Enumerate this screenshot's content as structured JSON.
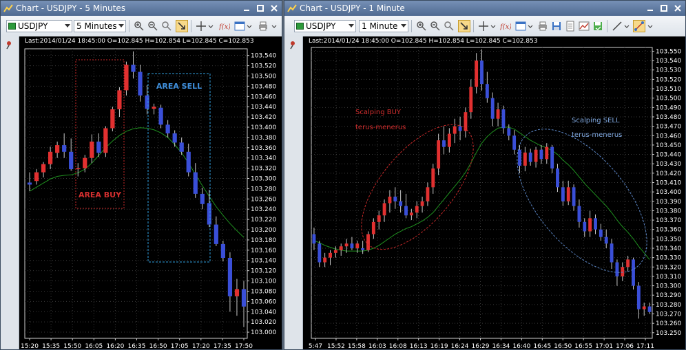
{
  "left": {
    "title": "Chart - USDJPY - 5 Minutes",
    "symbol": "USDJPY",
    "timeframe": "5 Minutes",
    "last_info": "Last:2014/01/24 18:45:00 O=102.845 H=102.854 L=102.845 C=102.853",
    "annotations": {
      "buy": "AREA BUY",
      "sell": "AREA SELL"
    },
    "colors": {
      "bull": "#e23030",
      "bear": "#3a4fd8",
      "ma": "#1f8f1f",
      "buy_box": "#c62828",
      "sell_box": "#2f9fe0"
    },
    "chart_data": {
      "type": "candlestick",
      "x_labels": [
        "15:20",
        "15:35",
        "15:50",
        "16:05",
        "16:20",
        "16:35",
        "16:50",
        "17:05",
        "17:20",
        "17:35",
        "17:50"
      ],
      "y_ticks": [
        "103.540",
        "103.520",
        "103.500",
        "103.480",
        "103.460",
        "103.440",
        "103.420",
        "103.400",
        "103.380",
        "103.360",
        "103.340",
        "103.320",
        "103.300",
        "103.280",
        "103.260",
        "103.240",
        "103.220",
        "103.200",
        "103.180",
        "103.160",
        "103.140",
        "103.120",
        "103.100",
        "103.080",
        "103.060",
        "103.040",
        "103.020",
        "103.000"
      ],
      "ylim": [
        102.988,
        103.553
      ],
      "candles": [
        [
          103.292,
          103.312,
          103.275,
          103.288
        ],
        [
          103.295,
          103.318,
          103.288,
          103.312
        ],
        [
          103.312,
          103.332,
          103.302,
          103.328
        ],
        [
          103.328,
          103.362,
          103.318,
          103.352
        ],
        [
          103.35,
          103.372,
          103.34,
          103.365
        ],
        [
          103.365,
          103.388,
          103.34,
          103.352
        ],
        [
          103.352,
          103.378,
          103.315,
          103.318
        ],
        [
          103.318,
          103.33,
          103.304,
          103.32
        ],
        [
          103.32,
          103.346,
          103.312,
          103.34
        ],
        [
          103.34,
          103.386,
          103.33,
          103.372
        ],
        [
          103.372,
          103.388,
          103.342,
          103.35
        ],
        [
          103.35,
          103.402,
          103.342,
          103.398
        ],
        [
          103.398,
          103.44,
          103.392,
          103.435
        ],
        [
          103.435,
          103.478,
          103.42,
          103.472
        ],
        [
          103.472,
          103.528,
          103.462,
          103.522
        ],
        [
          103.522,
          103.548,
          103.495,
          103.508
        ],
        [
          103.508,
          103.522,
          103.45,
          103.462
        ],
        [
          103.462,
          103.482,
          103.425,
          103.436
        ],
        [
          103.436,
          103.446,
          103.425,
          103.44
        ],
        [
          103.438,
          103.444,
          103.398,
          103.405
        ],
        [
          103.405,
          103.414,
          103.38,
          103.388
        ],
        [
          103.388,
          103.394,
          103.362,
          103.37
        ],
        [
          103.37,
          103.38,
          103.346,
          103.352
        ],
        [
          103.352,
          103.368,
          103.304,
          103.312
        ],
        [
          103.312,
          103.33,
          103.262,
          103.27
        ],
        [
          103.27,
          103.282,
          103.24,
          103.25
        ],
        [
          103.252,
          103.278,
          103.205,
          103.21
        ],
        [
          103.21,
          103.226,
          103.168,
          103.172
        ],
        [
          103.172,
          103.178,
          103.138,
          103.145
        ],
        [
          103.145,
          103.156,
          103.04,
          103.07
        ],
        [
          103.07,
          103.104,
          103.032,
          103.084
        ],
        [
          103.084,
          103.1,
          103.01,
          103.05
        ]
      ],
      "ma": [
        103.275,
        103.283,
        103.291,
        103.299,
        103.304,
        103.306,
        103.307,
        103.311,
        103.318,
        103.33,
        103.345,
        103.36,
        103.373,
        103.384,
        103.392,
        103.397,
        103.399,
        103.398,
        103.395,
        103.389,
        103.38,
        103.366,
        103.35,
        103.33,
        103.308,
        103.286,
        103.265,
        103.245,
        103.228,
        103.212,
        103.198,
        103.185
      ]
    }
  },
  "right": {
    "title": "Chart - USDJPY - 1 Minute",
    "symbol": "USDJPY",
    "timeframe": "1 Minute",
    "last_info": "Last:2014/01/24 18:45:00 O=102.845 H=102.854 L=102.845 C=102.853",
    "annotations": {
      "buy_line1": "Scalping BUY",
      "buy_line2": "terus-menerus",
      "sell_line1": "Scalping SELL",
      "sell_line2": "terus-menerus"
    },
    "colors": {
      "bull": "#e23030",
      "bear": "#3a4fd8",
      "ma": "#1f8f1f",
      "buy_ellipse": "#c62828",
      "sell_ellipse": "#5b86c6"
    },
    "chart_data": {
      "type": "candlestick",
      "x_labels": [
        "5:47",
        "15:52",
        "15:58",
        "16:03",
        "16:08",
        "16:13",
        "16:19",
        "16:24",
        "16:29",
        "16:34",
        "16:40",
        "16:45",
        "16:50",
        "16:55",
        "17:01",
        "17:06",
        "17:11"
      ],
      "y_ticks": [
        "103.550",
        "103.540",
        "103.530",
        "103.520",
        "103.510",
        "103.500",
        "103.490",
        "103.480",
        "103.470",
        "103.460",
        "103.450",
        "103.440",
        "103.430",
        "103.420",
        "103.410",
        "103.400",
        "103.390",
        "103.380",
        "103.370",
        "103.360",
        "103.350",
        "103.340",
        "103.330",
        "103.320",
        "103.310",
        "103.300",
        "103.290",
        "103.280",
        "103.270",
        "103.260",
        "103.250"
      ],
      "ylim": [
        103.244,
        103.554
      ],
      "candles": [
        [
          103.355,
          103.362,
          103.338,
          103.345
        ],
        [
          103.345,
          103.348,
          103.32,
          103.325
        ],
        [
          103.325,
          103.335,
          103.32,
          103.33
        ],
        [
          103.33,
          103.338,
          103.322,
          103.335
        ],
        [
          103.335,
          103.342,
          103.33,
          103.338
        ],
        [
          103.338,
          103.345,
          103.332,
          103.342
        ],
        [
          103.342,
          103.35,
          103.335,
          103.345
        ],
        [
          103.345,
          103.352,
          103.338,
          103.34
        ],
        [
          103.34,
          103.348,
          103.335,
          103.345
        ],
        [
          103.34,
          103.348,
          103.334,
          103.338
        ],
        [
          103.338,
          103.358,
          103.336,
          103.355
        ],
        [
          103.355,
          103.372,
          103.35,
          103.368
        ],
        [
          103.368,
          103.38,
          103.36,
          103.375
        ],
        [
          103.375,
          103.392,
          103.368,
          103.388
        ],
        [
          103.388,
          103.402,
          103.378,
          103.395
        ],
        [
          103.395,
          103.405,
          103.382,
          103.39
        ],
        [
          103.39,
          103.402,
          103.378,
          103.385
        ],
        [
          103.385,
          103.398,
          103.372,
          103.375
        ],
        [
          103.375,
          103.382,
          103.37,
          103.378
        ],
        [
          103.378,
          103.39,
          103.372,
          103.385
        ],
        [
          103.385,
          103.395,
          103.378,
          103.39
        ],
        [
          103.39,
          103.41,
          103.385,
          103.405
        ],
        [
          103.405,
          103.43,
          103.398,
          103.425
        ],
        [
          103.425,
          103.462,
          103.418,
          103.455
        ],
        [
          103.455,
          103.47,
          103.44,
          103.448
        ],
        [
          103.448,
          103.468,
          103.442,
          103.462
        ],
        [
          103.462,
          103.478,
          103.452,
          103.47
        ],
        [
          103.47,
          103.48,
          103.455,
          103.465
        ],
        [
          103.465,
          103.49,
          103.458,
          103.485
        ],
        [
          103.485,
          103.52,
          103.478,
          103.512
        ],
        [
          103.512,
          103.548,
          103.505,
          103.54
        ],
        [
          103.54,
          103.552,
          103.508,
          103.515
        ],
        [
          103.515,
          103.528,
          103.495,
          103.5
        ],
        [
          103.5,
          103.506,
          103.47,
          103.478
        ],
        [
          103.478,
          103.495,
          103.47,
          103.488
        ],
        [
          103.488,
          103.492,
          103.462,
          103.468
        ],
        [
          103.468,
          103.472,
          103.455,
          103.46
        ],
        [
          103.46,
          103.466,
          103.44,
          103.445
        ],
        [
          103.445,
          103.45,
          103.42,
          103.428
        ],
        [
          103.428,
          103.448,
          103.422,
          103.442
        ],
        [
          103.442,
          103.446,
          103.428,
          103.432
        ],
        [
          103.432,
          103.448,
          103.426,
          103.445
        ],
        [
          103.445,
          103.45,
          103.43,
          103.435
        ],
        [
          103.435,
          103.452,
          103.43,
          103.448
        ],
        [
          103.448,
          103.45,
          103.42,
          103.425
        ],
        [
          103.425,
          103.43,
          103.4,
          103.405
        ],
        [
          103.405,
          103.412,
          103.385,
          103.39
        ],
        [
          103.39,
          103.412,
          103.386,
          103.405
        ],
        [
          103.405,
          103.408,
          103.38,
          103.385
        ],
        [
          103.385,
          103.392,
          103.362,
          103.368
        ],
        [
          103.368,
          103.372,
          103.352,
          103.358
        ],
        [
          103.358,
          103.38,
          103.352,
          103.372
        ],
        [
          103.372,
          103.376,
          103.355,
          103.36
        ],
        [
          103.36,
          103.366,
          103.348,
          103.352
        ],
        [
          103.352,
          103.36,
          103.34,
          103.345
        ],
        [
          103.345,
          103.35,
          103.318,
          103.325
        ],
        [
          103.325,
          103.328,
          103.3,
          103.31
        ],
        [
          103.31,
          103.325,
          103.305,
          103.32
        ],
        [
          103.32,
          103.332,
          103.315,
          103.328
        ],
        [
          103.328,
          103.33,
          103.296,
          103.3
        ],
        [
          103.3,
          103.304,
          103.265,
          103.275
        ],
        [
          103.275,
          103.282,
          103.268,
          103.278
        ],
        [
          103.278,
          103.282,
          103.27,
          103.272
        ]
      ],
      "ma": [
        103.348,
        103.346,
        103.343,
        103.341,
        103.339,
        103.338,
        103.337,
        103.337,
        103.337,
        103.337,
        103.338,
        103.34,
        103.343,
        103.347,
        103.351,
        103.355,
        103.358,
        103.361,
        103.363,
        103.366,
        103.369,
        103.373,
        103.378,
        103.385,
        103.392,
        103.399,
        103.406,
        103.413,
        103.421,
        103.431,
        103.442,
        103.452,
        103.459,
        103.464,
        103.468,
        103.469,
        103.469,
        103.467,
        103.463,
        103.459,
        103.455,
        103.452,
        103.449,
        103.447,
        103.444,
        103.44,
        103.434,
        103.429,
        103.423,
        103.416,
        103.409,
        103.403,
        103.397,
        103.391,
        103.385,
        103.378,
        103.37,
        103.363,
        103.357,
        103.35,
        103.342,
        103.335,
        103.328
      ]
    }
  }
}
